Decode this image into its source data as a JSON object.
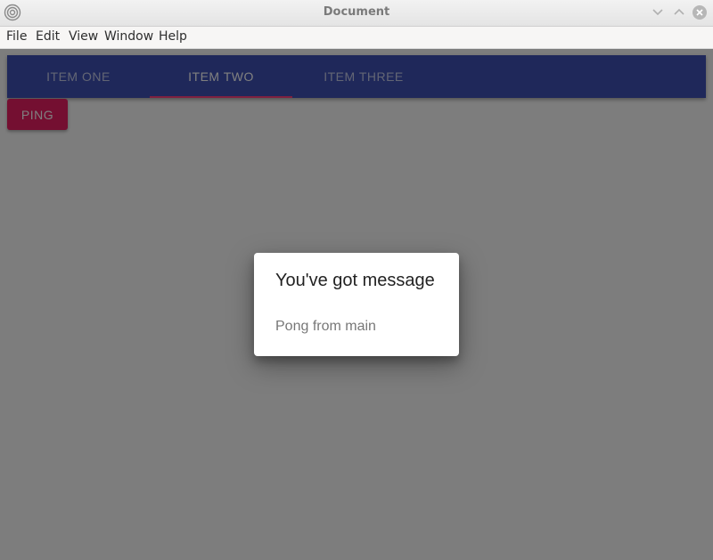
{
  "window": {
    "title": "Document",
    "icons": [
      "app-logo-icon",
      "minimize-icon",
      "maximize-icon",
      "close-icon"
    ]
  },
  "menubar": {
    "items": [
      "File",
      "Edit",
      "View",
      "Window",
      "Help"
    ]
  },
  "tabs": {
    "items": [
      "ITEM ONE",
      "ITEM TWO",
      "ITEM THREE"
    ],
    "selected": "ITEM TWO"
  },
  "actions": {
    "ping_label": "PING"
  },
  "dialog": {
    "title": "You've got message",
    "message": "Pong from main"
  },
  "colors": {
    "appbar": "#3f51b5",
    "accent": "#ff4081",
    "ping_button": "#e91e63"
  }
}
